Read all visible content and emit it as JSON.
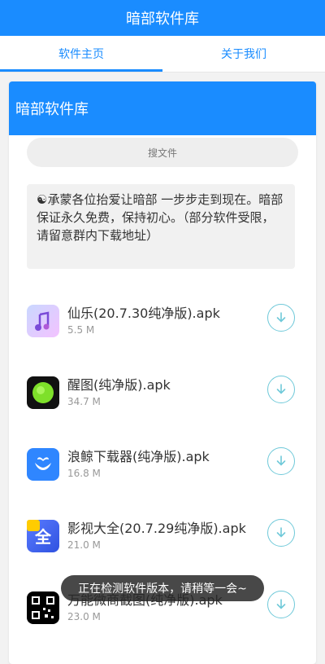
{
  "app_title": "暗部软件库",
  "tabs": [
    {
      "label": "软件主页",
      "active": true
    },
    {
      "label": "关于我们",
      "active": false
    }
  ],
  "card": {
    "title": "暗部软件库",
    "search_placeholder": "搜文件",
    "notice": "☯承蒙各位抬爱让暗部 一步步走到现在。暗部保证永久免费，保持初心。（部分软件受限，请留意群内下载地址）"
  },
  "files": [
    {
      "name": "仙乐(20.7.30纯净版).apk",
      "size": "5.5 M",
      "icon": "music-note-icon"
    },
    {
      "name": "醒图(纯净版).apk",
      "size": "34.7 M",
      "icon": "green-circle-icon"
    },
    {
      "name": "浪鲸下载器(纯净版).apk",
      "size": "16.8 M",
      "icon": "whale-icon"
    },
    {
      "name": "影视大全(20.7.29纯净版).apk",
      "size": "21.0 M",
      "icon": "quan-icon"
    },
    {
      "name": "万能微商截图(纯净版).apk",
      "size": "23.0 M",
      "icon": "qr-icon"
    }
  ],
  "toast": "正在检测软件版本，请稍等一会~",
  "colors": {
    "primary": "#1a8cff",
    "download_ring": "#6fc9d9"
  }
}
